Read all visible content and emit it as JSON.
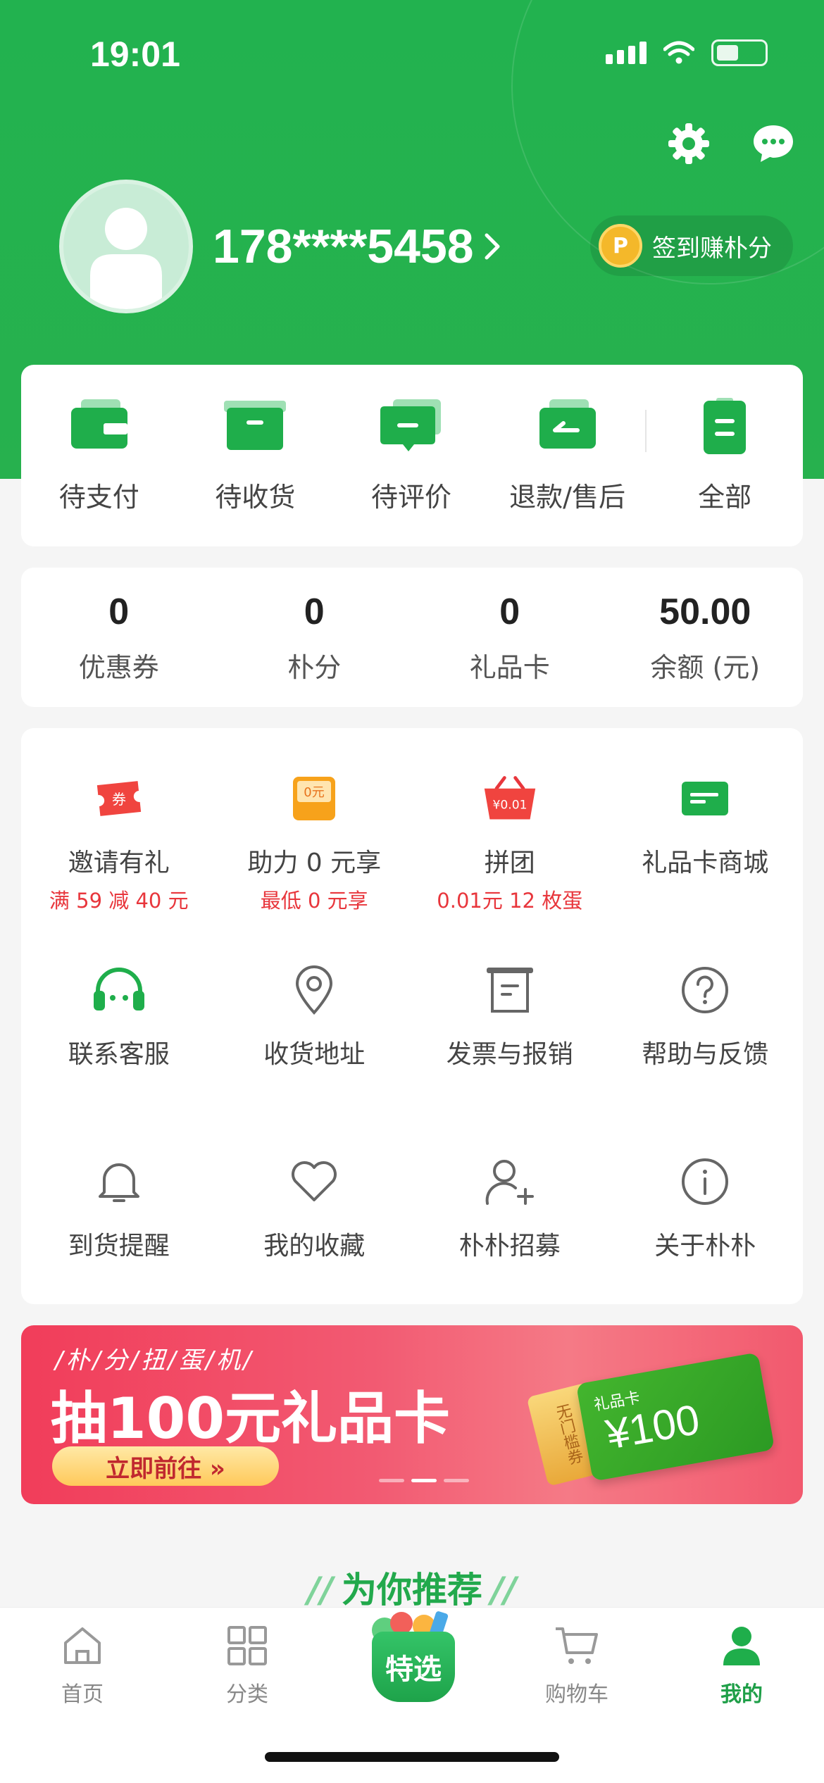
{
  "status": {
    "time": "19:01"
  },
  "user": {
    "phone": "178****5458"
  },
  "signin": {
    "label": "签到赚朴分"
  },
  "orders": [
    {
      "label": "待支付",
      "icon": "wallet-icon"
    },
    {
      "label": "待收货",
      "icon": "box-icon"
    },
    {
      "label": "待评价",
      "icon": "comment-icon"
    },
    {
      "label": "退款/售后",
      "icon": "refund-icon"
    },
    {
      "label": "全部",
      "icon": "clipboard-icon"
    }
  ],
  "stats": [
    {
      "value": "0",
      "label": "优惠券"
    },
    {
      "value": "0",
      "label": "朴分"
    },
    {
      "value": "0",
      "label": "礼品卡"
    },
    {
      "value": "50.00",
      "label": "余额 (元)"
    }
  ],
  "services": [
    {
      "label": "邀请有礼",
      "sub": "满 59 减 40 元",
      "icon": "coupon-icon",
      "icon_text": "券"
    },
    {
      "label": "助力 0 元享",
      "sub": "最低 0 元享",
      "icon": "zero-yuan-icon",
      "icon_text": "0元"
    },
    {
      "label": "拼团",
      "sub": "0.01元 12 枚蛋",
      "icon": "basket-icon",
      "icon_text": "¥0.01"
    },
    {
      "label": "礼品卡商城",
      "sub": "",
      "icon": "gift-card-icon"
    },
    {
      "label": "联系客服",
      "icon": "headset-icon"
    },
    {
      "label": "收货地址",
      "icon": "location-icon"
    },
    {
      "label": "发票与报销",
      "icon": "invoice-icon"
    },
    {
      "label": "帮助与反馈",
      "icon": "help-icon"
    },
    {
      "label": "到货提醒",
      "icon": "bell-icon"
    },
    {
      "label": "我的收藏",
      "icon": "heart-icon"
    },
    {
      "label": "朴朴招募",
      "icon": "add-user-icon"
    },
    {
      "label": "关于朴朴",
      "icon": "info-icon"
    }
  ],
  "banner": {
    "tag": "/朴/分/扭/蛋/机/",
    "title": "抽100元礼品卡",
    "button": "立即前往 »",
    "card_label": "礼品卡",
    "card_amount": "¥100",
    "ticket_text": "无门槛券",
    "active_slide": 2,
    "slide_count": 3
  },
  "recommend": {
    "title": "为你推荐"
  },
  "tabbar": [
    {
      "label": "首页",
      "icon": "home-icon",
      "active": false
    },
    {
      "label": "分类",
      "icon": "grid-icon",
      "active": false
    },
    {
      "label": "特选",
      "icon": "featured-basket-icon",
      "active": false
    },
    {
      "label": "购物车",
      "icon": "cart-icon",
      "active": false
    },
    {
      "label": "我的",
      "icon": "user-icon",
      "active": true
    }
  ],
  "colors": {
    "brand": "#22b24f",
    "accent_red": "#e8363c",
    "text": "#444444"
  }
}
